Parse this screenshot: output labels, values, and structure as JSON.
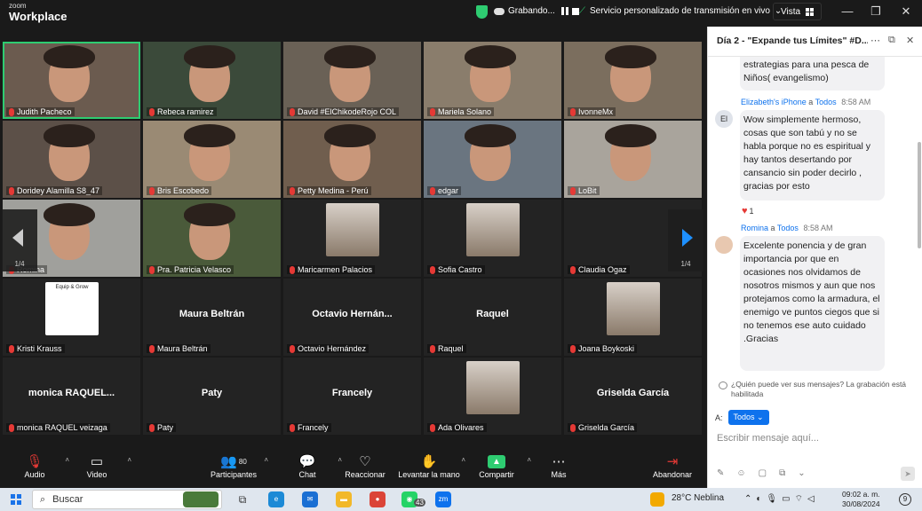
{
  "titlebar": {
    "logo_small": "zoom",
    "logo_big": "Workplace",
    "recording": "Grabando...",
    "stream": "Servicio personalizado de transmisión en vivo",
    "stream_caret": "⌄",
    "vista": "Vista",
    "minimize": "—",
    "restore": "❐",
    "close": "✕"
  },
  "pager": {
    "left_label": "1/4",
    "right_label": "1/4"
  },
  "tiles": [
    {
      "name": "Judith Pacheco",
      "type": "video"
    },
    {
      "name": "Rebeca ramirez",
      "type": "video"
    },
    {
      "name": "David #ElChikodeRojo COL",
      "type": "video"
    },
    {
      "name": "Mariela Solano",
      "type": "video"
    },
    {
      "name": "IvonneMx",
      "type": "video"
    },
    {
      "name": "Doridey Alamilla S8_47",
      "type": "video"
    },
    {
      "name": "Bris Escobedo",
      "type": "video"
    },
    {
      "name": "Petty Medina - Perú",
      "type": "video"
    },
    {
      "name": "edgar",
      "type": "video"
    },
    {
      "name": "LoBit",
      "type": "video"
    },
    {
      "name": "Romina",
      "type": "video"
    },
    {
      "name": "Pra. Patricia Velasco",
      "type": "video"
    },
    {
      "name": "Maricarmen Palacios",
      "type": "photo"
    },
    {
      "name": "Sofia Castro",
      "type": "photo"
    },
    {
      "name": "Claudia Ogaz",
      "type": "blank"
    },
    {
      "name": "Kristi Krauss",
      "type": "logo",
      "logo_text": "Equip & Grow"
    },
    {
      "name": "Maura Beltrán",
      "type": "text",
      "big": "Maura Beltrán"
    },
    {
      "name": "Octavio Hernández",
      "type": "text",
      "big": "Octavio Hernán..."
    },
    {
      "name": "Raquel",
      "type": "text",
      "big": "Raquel"
    },
    {
      "name": "Joana Boykoski",
      "type": "photo"
    },
    {
      "name": "monica RAQUEL veizaga",
      "type": "text",
      "big": "monica RAQUEL..."
    },
    {
      "name": "Paty",
      "type": "text",
      "big": "Paty"
    },
    {
      "name": "Francely",
      "type": "text",
      "big": "Francely"
    },
    {
      "name": "Ada Olivares",
      "type": "photo"
    },
    {
      "name": "Griselda García",
      "type": "text",
      "big": "Griselda García"
    }
  ],
  "toolbar": {
    "audio": "Audio",
    "video": "Video",
    "participants": "Participantes",
    "participants_count": "80",
    "chat": "Chat",
    "react": "Reaccionar",
    "raise": "Levantar la mano",
    "share": "Compartir",
    "more": "Más",
    "leave": "Abandonar"
  },
  "chat": {
    "title": "Día 2 - \"Expande tus Límites\" #D...",
    "messages": [
      {
        "text": "estrategias para una pesca de Niños( evangelismo)"
      },
      {
        "sender": "Elizabeth's iPhone",
        "to": "a",
        "to_name": "Todos",
        "time": "8:58 AM",
        "avatar": "El",
        "text": "Wow simplemente hermoso, cosas que son tabú y no se habla porque no es espiritual y hay tantos desertando por cansancio sin poder decirlo , gracias por esto",
        "reaction_count": "1"
      },
      {
        "sender": "Romina",
        "to": "a",
        "to_name": "Todos",
        "time": "8:58 AM",
        "text": "Excelente ponencia y de gran importancia por que en ocasiones nos olvidamos de nosotros mismos y aun que nos protejamos como la armadura, el enemigo ve puntos ciegos que si no tenemos ese auto cuidado .Gracias"
      }
    ],
    "notice": "¿Quién puede ver sus mensajes? La grabación está habilitada",
    "to_label": "A:",
    "to_value": "Todos",
    "input_placeholder": "Escribir mensaje aquí..."
  },
  "taskbar": {
    "search": "Buscar",
    "whatsapp_badge": "43",
    "weather": "28°C  Neblina",
    "time": "09:02 a. m.",
    "date": "30/08/2024",
    "notif": "9"
  },
  "colors": {
    "active_speaker": "#2ecc71",
    "share_green": "#2ecc71",
    "link_blue": "#0e72ed",
    "muted_red": "#e53935"
  }
}
